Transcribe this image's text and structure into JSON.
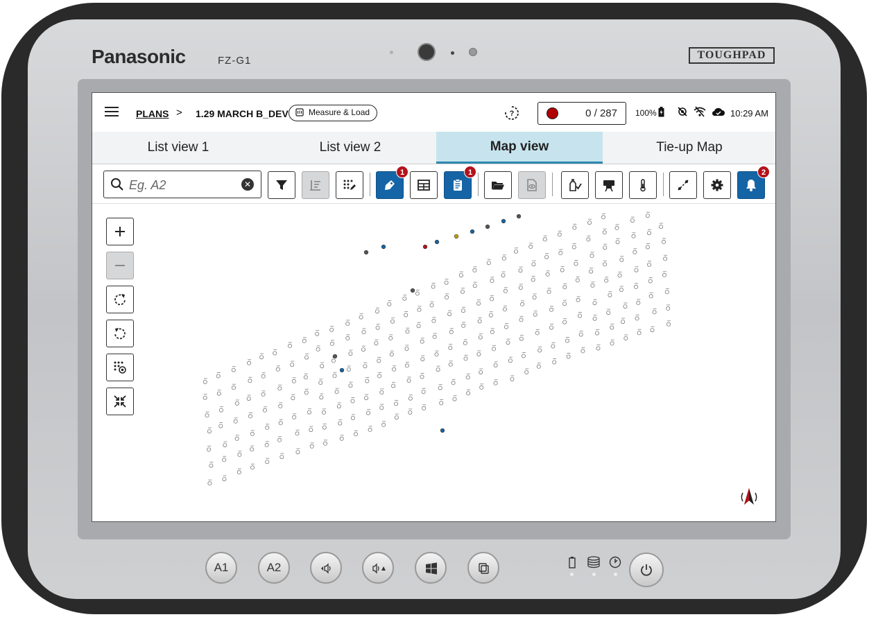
{
  "device": {
    "brand": "Panasonic",
    "model": "FZ-G1",
    "product_line": "TOUGHPAD",
    "hardware_buttons": [
      "A1",
      "A2"
    ]
  },
  "app": {
    "breadcrumb": {
      "root": "PLANS",
      "separator": ">",
      "current": "1.29 MARCH B_DEV"
    },
    "measure_load_label": "Measure & Load",
    "recording": {
      "count": "0 / 287",
      "dot_color": "#b00000"
    },
    "status": {
      "battery": "100%",
      "time": "10:29 AM"
    },
    "tabs": [
      {
        "label": "List view 1",
        "active": false
      },
      {
        "label": "List view 2",
        "active": false
      },
      {
        "label": "Map view",
        "active": true
      },
      {
        "label": "Tie-up Map",
        "active": false
      }
    ],
    "search": {
      "placeholder": "Eg. A2",
      "value": ""
    },
    "toolbar": {
      "badge_tag": "1",
      "badge_clipboard": "1",
      "badge_notifications": "2"
    },
    "colors": {
      "accent_blue": "#1565a6",
      "active_tab": "#c7e4ee",
      "badge_red": "#b3121a"
    }
  }
}
